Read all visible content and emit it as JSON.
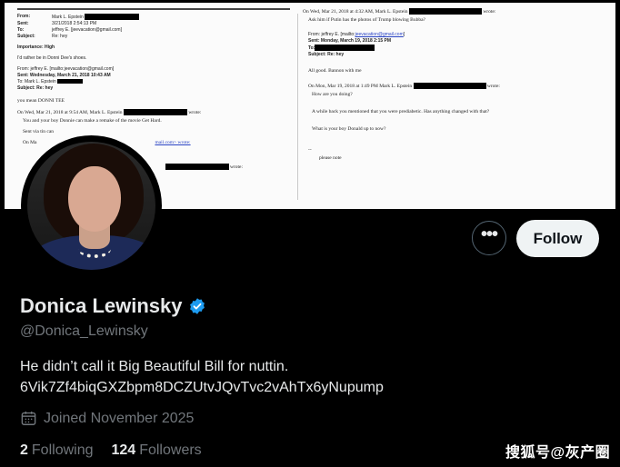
{
  "banner": {
    "left": {
      "header": [
        {
          "key": "From:",
          "value": "Mark L. Epstein"
        },
        {
          "key": "Sent:",
          "value": "3/21/2018 2:54:13 PM"
        },
        {
          "key": "To:",
          "value": "jeffrey E. [jeevacation@gmail.com]"
        },
        {
          "key": "Subject:",
          "value": "Re: hey"
        }
      ],
      "importance": "Importance:  High",
      "line1": "I'd rather be in Donni Dee's shoes.",
      "quoted_header": [
        "From: jeffrey E. [mailto:jeevacation@gmail.com]",
        "Sent: Wednesday, March 21, 2018 10:43 AM",
        "To: Mark L. Epstein",
        "Subject: Re: hey"
      ],
      "you_mean": "you mean DONNI TEE",
      "on_wrote": "On Wed, Mar 21, 2018 at 9:54 AM, Mark L. Epstein",
      "wrote": "wrote:",
      "body1": "You and your boy Donnie can make a remake of the movie Get Hard.",
      "body2": "Sent via tin can",
      "body3": "On Ma",
      "body3_end": "mail.com> wrote:",
      "body4": "wrote:"
    },
    "right": {
      "on_wrote": "On Wed, Mar 21, 2018 at 4:32 AM, Mark L. Epstein",
      "wrote": "wrote:",
      "ask": "Ask him if Putin has the photos of Trump blowing Bubba?",
      "from": "From: jeffrey E. [mailto:jeevacation@gmail.com]",
      "sent": "Sent: Monday, March 19, 2018 2:15 PM",
      "to": "To:",
      "subject": "Subject: Re: hey",
      "all_good": "All good. Bannon with me",
      "on_wrote2": "On Mon, Mar 19, 2018 at 1:49 PM Mark L. Epstein",
      "wrote2": "wrote:",
      "q1": "How are you doing?",
      "q2": "A while back you mentioned that you were prediabetic.  Has anything changed with that?",
      "q3": "What is your boy Donald up to now?",
      "dash": "--",
      "please": "please note"
    }
  },
  "profile": {
    "display_name": "Donica Lewinsky",
    "handle": "@Donica_Lewinsky",
    "bio_line1": "He didn’t call it Big Beautiful Bill for nuttin.",
    "bio_line2": "6Vik7Zf4biqGXZbpm8DCZUtvJQvTvc2vAhTx6yNupump",
    "joined": "Joined November 2025",
    "following_count": "2",
    "following_label": "Following",
    "followers_count": "124",
    "followers_label": "Followers",
    "verified_color": "#1d9bf0"
  },
  "actions": {
    "more_label": "•••",
    "follow_label": "Follow"
  },
  "watermark": "搜狐号@灰产圈"
}
